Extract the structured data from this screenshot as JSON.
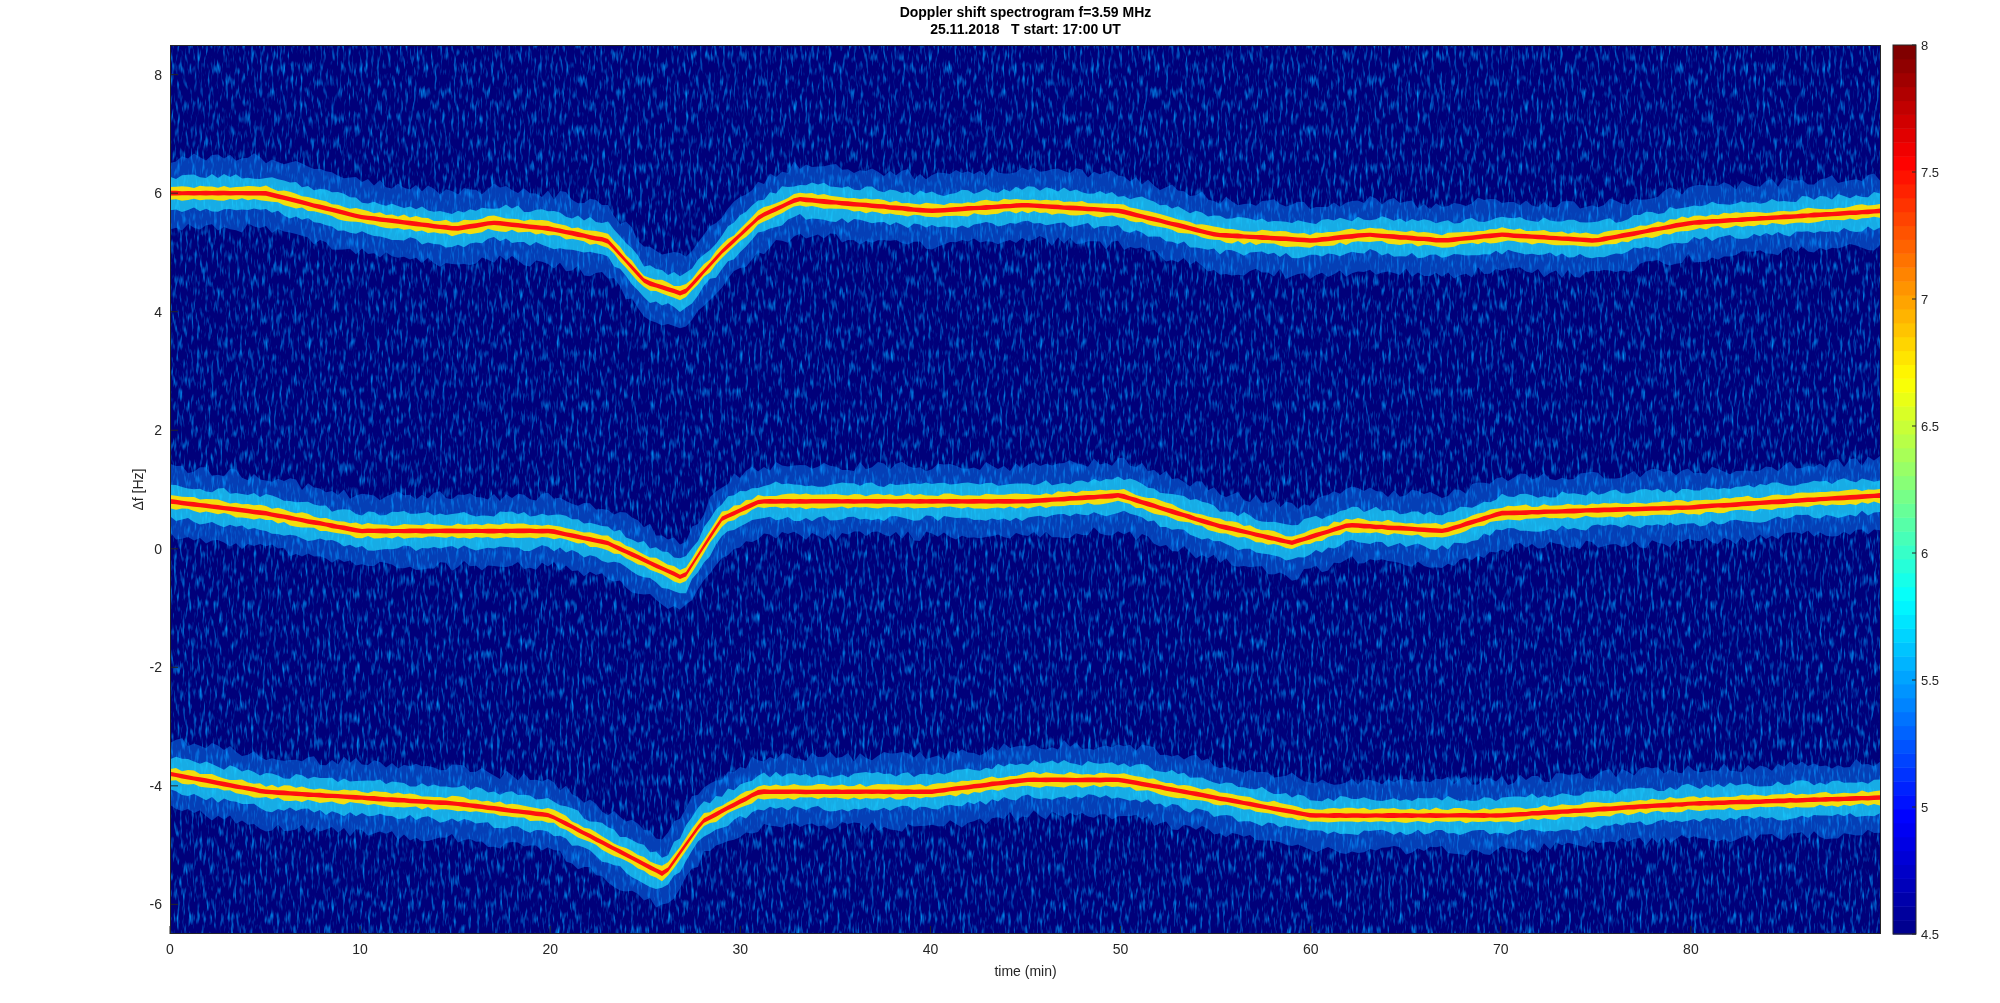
{
  "plot": {
    "title": [
      "Doppler shift spectrogram f=3.59 MHz",
      "25.11.2018   T start: 17:00 UT"
    ],
    "xlabel": "time (min)",
    "ylabel": "Δf [Hz]",
    "xticks": [
      "0",
      "10",
      "20",
      "30",
      "40",
      "50",
      "60",
      "70",
      "80"
    ],
    "yticks": [
      "8",
      "6",
      "4",
      "2",
      "0",
      "-2",
      "-4",
      "-6"
    ],
    "colorbar": {
      "ticks": [
        "8",
        "7.5",
        "7",
        "6.5",
        "6",
        "5.5",
        "5",
        "4.5"
      ]
    }
  }
}
